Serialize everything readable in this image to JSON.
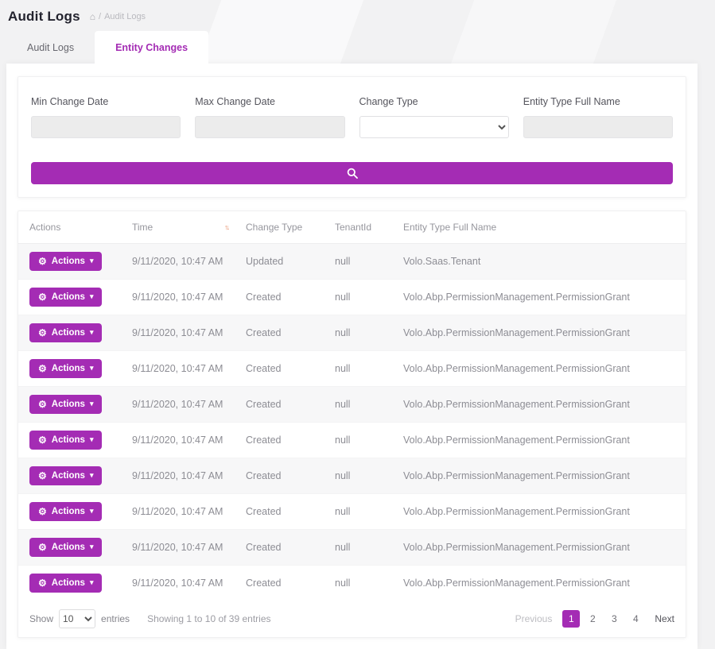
{
  "colors": {
    "accent": "#a42cb4"
  },
  "icons": {
    "home": "⌂",
    "gear": "⚙",
    "caret_down": "▾",
    "sort": "↑↓"
  },
  "page": {
    "title": "Audit Logs",
    "breadcrumb": {
      "separator": "/",
      "current": "Audit Logs"
    }
  },
  "tabs": [
    {
      "label": "Audit Logs",
      "active": false
    },
    {
      "label": "Entity Changes",
      "active": true
    }
  ],
  "filters": {
    "fields": [
      {
        "label": "Min Change Date",
        "value": ""
      },
      {
        "label": "Max Change Date",
        "value": ""
      },
      {
        "label": "Change Type",
        "value": ""
      },
      {
        "label": "Entity Type Full Name",
        "value": ""
      }
    ]
  },
  "table": {
    "columns": [
      "Actions",
      "Time",
      "Change Type",
      "TenantId",
      "Entity Type Full Name"
    ],
    "actions_button_label": "Actions",
    "rows": [
      {
        "time": "9/11/2020, 10:47 AM",
        "change_type": "Updated",
        "tenant_id": "null",
        "entity_type": "Volo.Saas.Tenant"
      },
      {
        "time": "9/11/2020, 10:47 AM",
        "change_type": "Created",
        "tenant_id": "null",
        "entity_type": "Volo.Abp.PermissionManagement.PermissionGrant"
      },
      {
        "time": "9/11/2020, 10:47 AM",
        "change_type": "Created",
        "tenant_id": "null",
        "entity_type": "Volo.Abp.PermissionManagement.PermissionGrant"
      },
      {
        "time": "9/11/2020, 10:47 AM",
        "change_type": "Created",
        "tenant_id": "null",
        "entity_type": "Volo.Abp.PermissionManagement.PermissionGrant"
      },
      {
        "time": "9/11/2020, 10:47 AM",
        "change_type": "Created",
        "tenant_id": "null",
        "entity_type": "Volo.Abp.PermissionManagement.PermissionGrant"
      },
      {
        "time": "9/11/2020, 10:47 AM",
        "change_type": "Created",
        "tenant_id": "null",
        "entity_type": "Volo.Abp.PermissionManagement.PermissionGrant"
      },
      {
        "time": "9/11/2020, 10:47 AM",
        "change_type": "Created",
        "tenant_id": "null",
        "entity_type": "Volo.Abp.PermissionManagement.PermissionGrant"
      },
      {
        "time": "9/11/2020, 10:47 AM",
        "change_type": "Created",
        "tenant_id": "null",
        "entity_type": "Volo.Abp.PermissionManagement.PermissionGrant"
      },
      {
        "time": "9/11/2020, 10:47 AM",
        "change_type": "Created",
        "tenant_id": "null",
        "entity_type": "Volo.Abp.PermissionManagement.PermissionGrant"
      },
      {
        "time": "9/11/2020, 10:47 AM",
        "change_type": "Created",
        "tenant_id": "null",
        "entity_type": "Volo.Abp.PermissionManagement.PermissionGrant"
      }
    ]
  },
  "footer": {
    "show_label": "Show",
    "page_size": "10",
    "entries_label": "entries",
    "summary": "Showing 1 to 10 of 39 entries",
    "pagination": {
      "previous_label": "Previous",
      "pages": [
        "1",
        "2",
        "3",
        "4"
      ],
      "active_page": "1",
      "next_label": "Next"
    }
  }
}
